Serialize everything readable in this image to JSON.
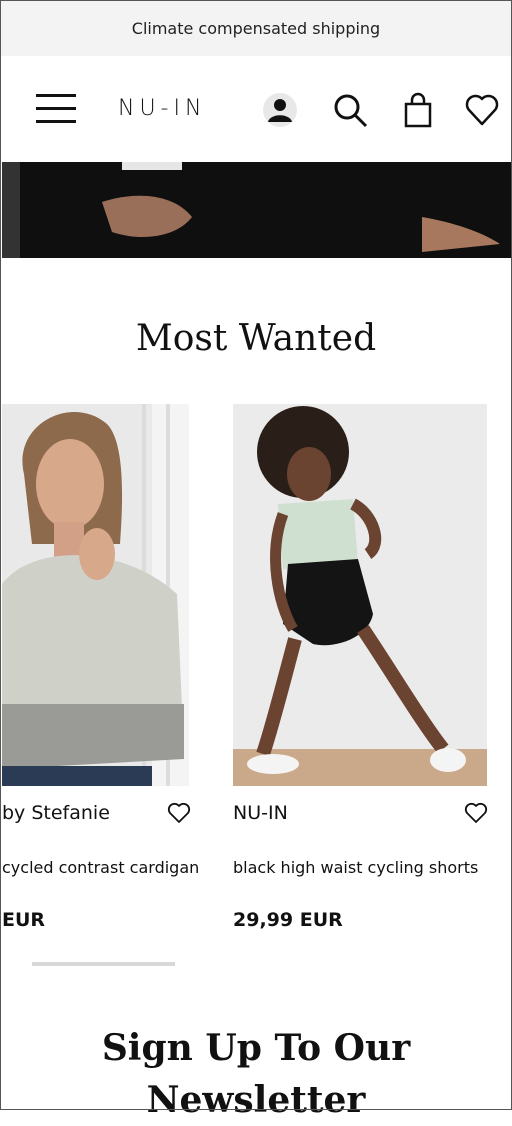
{
  "promo": {
    "text": "Climate compensated shipping"
  },
  "header": {
    "logo": "NU-IN",
    "icons": [
      "menu-icon",
      "account-icon",
      "search-icon",
      "bag-icon",
      "heart-icon"
    ]
  },
  "section": {
    "title": "Most Wanted"
  },
  "products": [
    {
      "brand": "by Stefanie",
      "name": "cycled contrast cardigan",
      "price": "EUR"
    },
    {
      "brand": "NU-IN",
      "name": "black high waist cycling shorts",
      "price": "29,99 EUR"
    }
  ],
  "newsletter": {
    "title": "Sign Up To Our Newsletter"
  }
}
